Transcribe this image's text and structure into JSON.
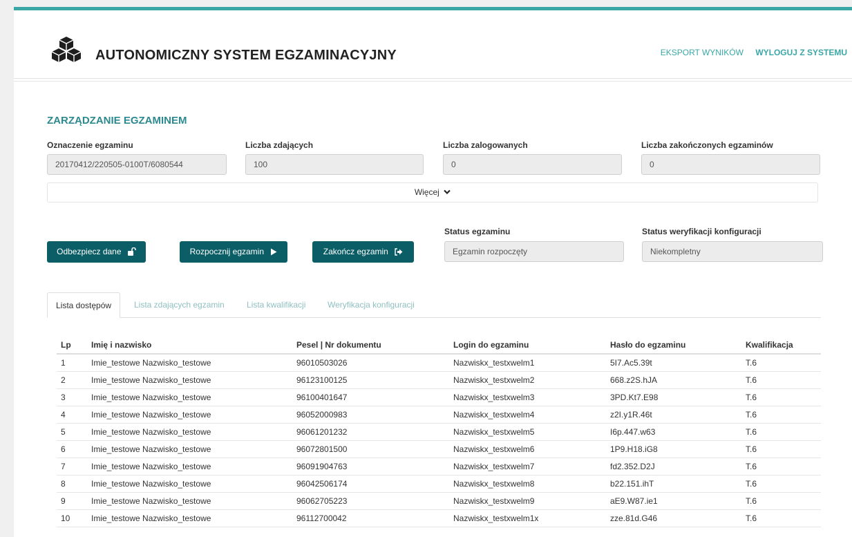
{
  "header": {
    "title": "AUTONOMICZNY SYSTEM EGZAMINACYJNY",
    "nav": {
      "export_label": "EKSPORT WYNIKÓW",
      "logout_label": "WYLOGUJ Z SYSTEMU"
    }
  },
  "exam": {
    "section_title": "ZARZĄDZANIE EGZAMINEM",
    "fields": [
      {
        "label": "Oznaczenie egzaminu",
        "value": "20170412/220505-0100T/6080544"
      },
      {
        "label": "Liczba zdających",
        "value": "100"
      },
      {
        "label": "Liczba zalogowanych",
        "value": "0"
      },
      {
        "label": "Liczba zakończonych egzaminów",
        "value": "0"
      }
    ],
    "more_label": "Więcej",
    "buttons": {
      "unlock": "Odbezpiecz dane",
      "start": "Rozpocznij egzamin",
      "finish": "Zakończ egzamin"
    },
    "status": {
      "exam_label": "Status egzaminu",
      "exam_value": "Egzamin rozpoczęty",
      "config_label": "Status weryfikacji konfiguracji",
      "config_value": "Niekompletny"
    }
  },
  "tabs": [
    {
      "label": "Lista dostępów",
      "active": true
    },
    {
      "label": "Lista zdających egzamin",
      "active": false
    },
    {
      "label": "Lista kwalifikacji",
      "active": false
    },
    {
      "label": "Weryfikacja konfiguracji",
      "active": false
    }
  ],
  "table": {
    "columns": [
      "Lp",
      "Imię i nazwisko",
      "Pesel | Nr dokumentu",
      "Login do egzaminu",
      "Hasło do egzaminu",
      "Kwalifikacja"
    ],
    "rows": [
      [
        "1",
        "Imie_testowe Nazwisko_testowe",
        "96010503026",
        "Nazwiskx_testxwelm1",
        "5I7.Ac5.39t",
        "T.6"
      ],
      [
        "2",
        "Imie_testowe Nazwisko_testowe",
        "96123100125",
        "Nazwiskx_testxwelm2",
        "668.z2S.hJA",
        "T.6"
      ],
      [
        "3",
        "Imie_testowe Nazwisko_testowe",
        "96100401647",
        "Nazwiskx_testxwelm3",
        "3PD.Kt7.E98",
        "T.6"
      ],
      [
        "4",
        "Imie_testowe Nazwisko_testowe",
        "96052000983",
        "Nazwiskx_testxwelm4",
        "z2I.y1R.46t",
        "T.6"
      ],
      [
        "5",
        "Imie_testowe Nazwisko_testowe",
        "96061201232",
        "Nazwiskx_testxwelm5",
        "I6p.447.w63",
        "T.6"
      ],
      [
        "6",
        "Imie_testowe Nazwisko_testowe",
        "96072801500",
        "Nazwiskx_testxwelm6",
        "1P9.H18.iG8",
        "T.6"
      ],
      [
        "7",
        "Imie_testowe Nazwisko_testowe",
        "96091904763",
        "Nazwiskx_testxwelm7",
        "fd2.352.D2J",
        "T.6"
      ],
      [
        "8",
        "Imie_testowe Nazwisko_testowe",
        "96042506174",
        "Nazwiskx_testxwelm8",
        "b22.151.ihT",
        "T.6"
      ],
      [
        "9",
        "Imie_testowe Nazwisko_testowe",
        "96062705223",
        "Nazwiskx_testxwelm9",
        "aE9.W87.ie1",
        "T.6"
      ],
      [
        "10",
        "Imie_testowe Nazwisko_testowe",
        "96112700042",
        "Nazwiskx_testxwelm1x",
        "zze.81d.G46",
        "T.6"
      ]
    ]
  },
  "colors": {
    "accent": "#3aa7a6",
    "button": "#0b5e66",
    "heading": "#2c8a8f"
  }
}
